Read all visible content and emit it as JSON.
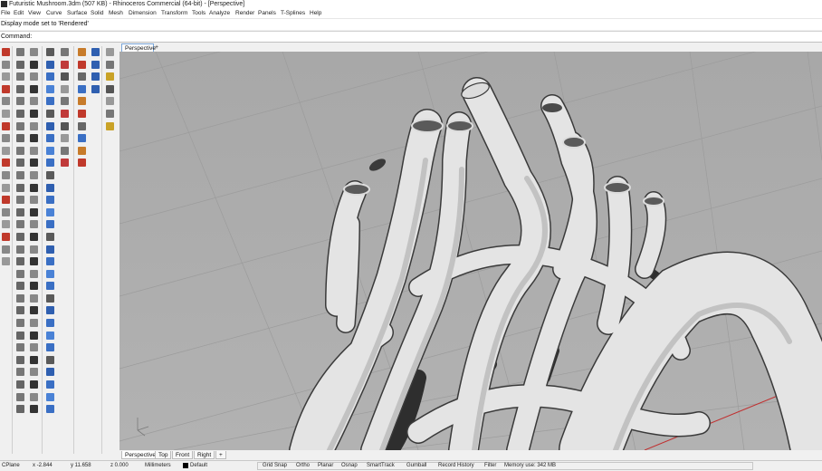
{
  "titlebar": {
    "title": "Futuristic Mushroom.3dm (507 KB) - Rhinoceros Commercial (64-bit) - [Perspective]"
  },
  "menu": [
    "File",
    "Edit",
    "View",
    "Curve",
    "Surface",
    "Solid",
    "Mesh",
    "Dimension",
    "Transform",
    "Tools",
    "Analyze",
    "Render",
    "Panels",
    "T-Splines",
    "Help"
  ],
  "command": {
    "history": "Display mode set to 'Rendered'",
    "prompt": "Command:"
  },
  "viewport": {
    "tab": "Perspective",
    "add": "+"
  },
  "view_tabs": [
    "Perspective",
    "Top",
    "Front",
    "Right",
    "+"
  ],
  "status": {
    "cplane": "CPlane",
    "x": "x -2.844",
    "y": "y 11.658",
    "z": "z 0.000",
    "units": "Millimeters",
    "layer": "Default",
    "toggles": [
      "Grid Snap",
      "Ortho",
      "Planar",
      "Osnap",
      "SmartTrack",
      "Gumball",
      "Record History",
      "Filter"
    ],
    "memory": "Memory use: 342 MB"
  },
  "colors": {
    "viewport_bg": "#a9a9a9",
    "surface": "#e6e6e6",
    "axis_red": "#c03030",
    "accent": "#7aa6d9"
  }
}
